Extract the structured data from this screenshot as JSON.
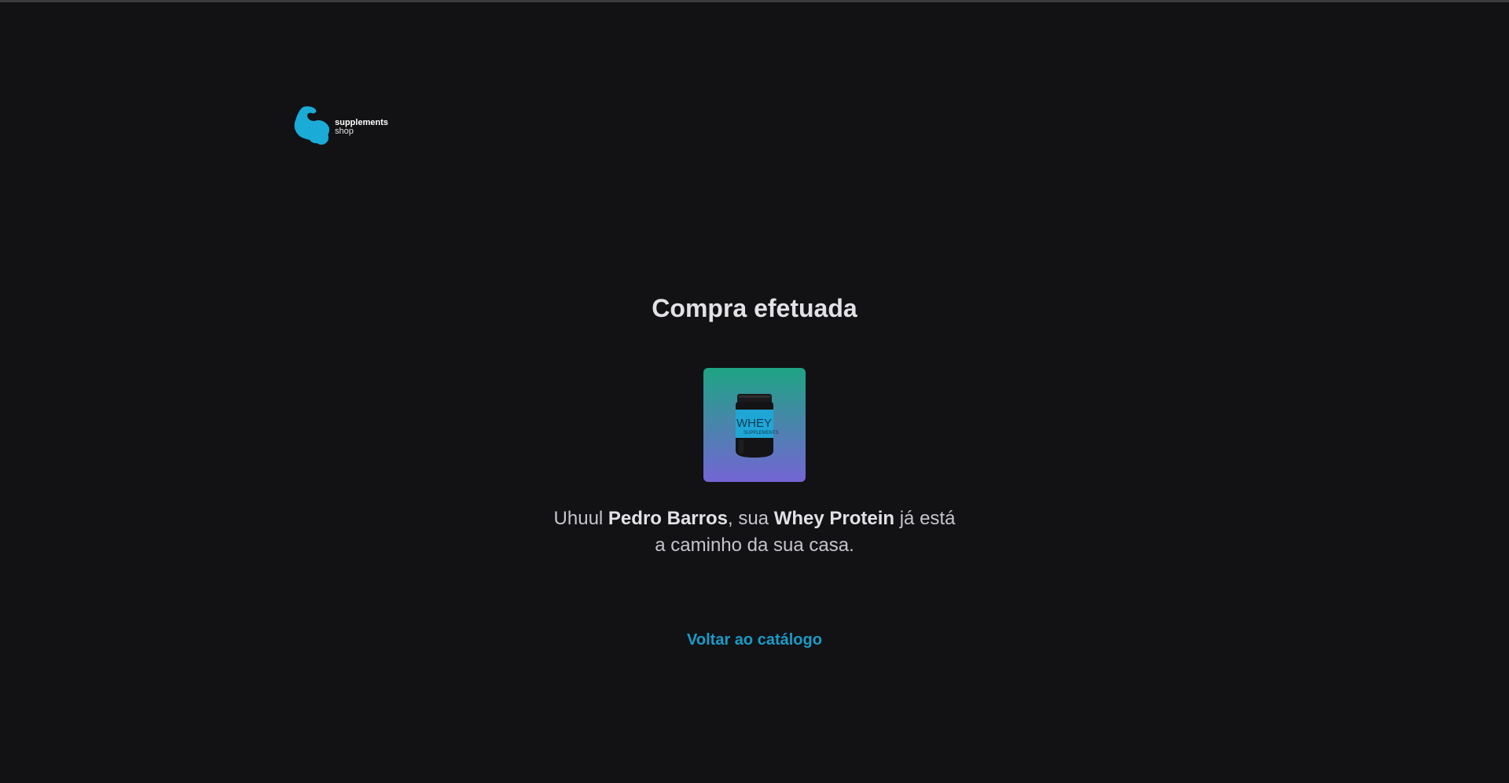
{
  "brand": {
    "line1": "supplements",
    "line2": "shop",
    "icon": "flexed-arm-icon",
    "color": "#1AABD7"
  },
  "page": {
    "title": "Compra efetuada"
  },
  "product": {
    "image_label_main": "WHEY",
    "image_label_sub": "SUPPLEMENTS",
    "gradient_top": "#1EA483",
    "gradient_bottom": "#7465D4"
  },
  "message": {
    "prefix": "Uhuul ",
    "customer_name": "Pedro Barros",
    "middle": ", sua ",
    "product_name": "Whey Protein",
    "suffix": " já está a caminho da sua casa."
  },
  "actions": {
    "back_label": "Voltar ao catálogo"
  },
  "colors": {
    "background": "#121214",
    "text": "#E1E1E6",
    "link": "#1A9BC7"
  }
}
